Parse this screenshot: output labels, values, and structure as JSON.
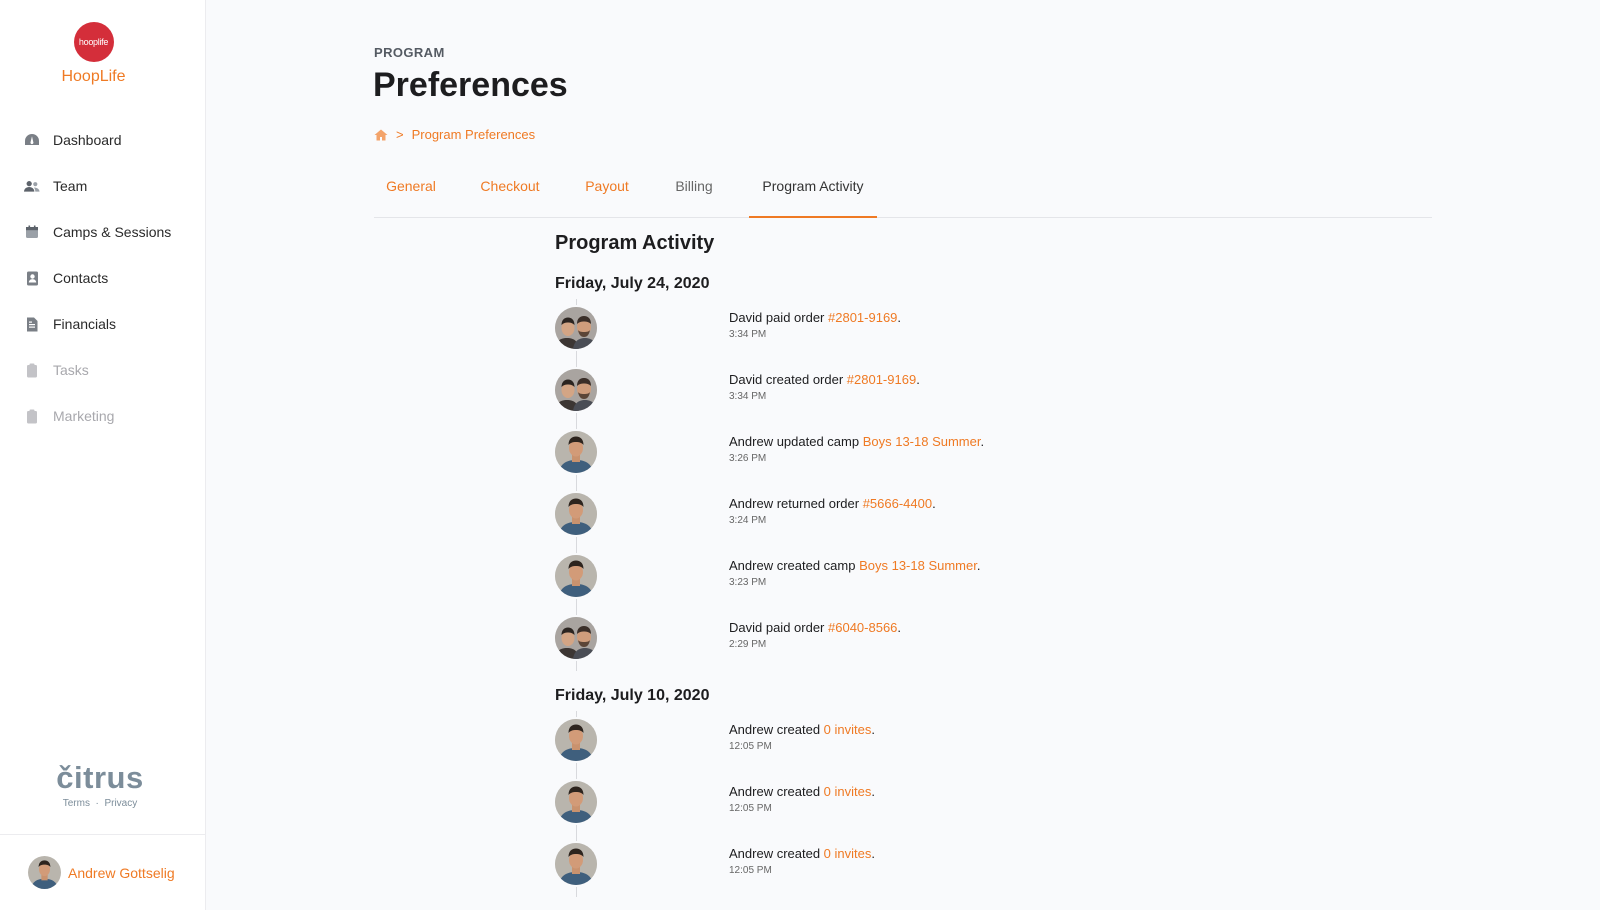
{
  "brand": {
    "logo_text": "hooplife",
    "name": "HoopLife"
  },
  "sidebar": {
    "items": [
      {
        "label": "Dashboard",
        "icon": "dashboard-icon",
        "enabled": true
      },
      {
        "label": "Team",
        "icon": "team-icon",
        "enabled": true
      },
      {
        "label": "Camps & Sessions",
        "icon": "calendar-icon",
        "enabled": true
      },
      {
        "label": "Contacts",
        "icon": "contacts-icon",
        "enabled": true
      },
      {
        "label": "Financials",
        "icon": "financials-icon",
        "enabled": true
      },
      {
        "label": "Tasks",
        "icon": "tasks-icon",
        "enabled": false
      },
      {
        "label": "Marketing",
        "icon": "marketing-icon",
        "enabled": false
      }
    ],
    "footer_brand": "čitrus",
    "terms": "Terms",
    "separator": "·",
    "privacy": "Privacy",
    "user": {
      "name": "Andrew Gottselig"
    }
  },
  "header": {
    "eyebrow": "PROGRAM",
    "title": "Preferences",
    "breadcrumb": {
      "separator": ">",
      "current": "Program Preferences"
    }
  },
  "tabs": [
    {
      "label": "General",
      "state": "link"
    },
    {
      "label": "Checkout",
      "state": "link"
    },
    {
      "label": "Payout",
      "state": "link"
    },
    {
      "label": "Billing",
      "state": "muted"
    },
    {
      "label": "Program Activity",
      "state": "active"
    }
  ],
  "activity": {
    "title": "Program Activity",
    "days": [
      {
        "date": "Friday, July 24, 2020",
        "items": [
          {
            "who": "david",
            "prefix": "David paid order ",
            "link": "#2801-9169",
            "suffix": ".",
            "time": "3:34 PM"
          },
          {
            "who": "david",
            "prefix": "David created order ",
            "link": "#2801-9169",
            "suffix": ".",
            "time": "3:34 PM"
          },
          {
            "who": "andrew",
            "prefix": "Andrew updated camp ",
            "link": "Boys 13-18 Summer",
            "suffix": ".",
            "time": "3:26 PM"
          },
          {
            "who": "andrew",
            "prefix": "Andrew returned order ",
            "link": "#5666-4400",
            "suffix": ".",
            "time": "3:24 PM"
          },
          {
            "who": "andrew",
            "prefix": "Andrew created camp ",
            "link": "Boys 13-18 Summer",
            "suffix": ".",
            "time": "3:23 PM"
          },
          {
            "who": "david",
            "prefix": "David paid order ",
            "link": "#6040-8566",
            "suffix": ".",
            "time": "2:29 PM"
          }
        ]
      },
      {
        "date": "Friday, July 10, 2020",
        "items": [
          {
            "who": "andrew",
            "prefix": "Andrew created ",
            "link": "0 invites",
            "suffix": ".",
            "time": "12:05 PM"
          },
          {
            "who": "andrew",
            "prefix": "Andrew created ",
            "link": "0 invites",
            "suffix": ".",
            "time": "12:05 PM"
          },
          {
            "who": "andrew",
            "prefix": "Andrew created ",
            "link": "0 invites",
            "suffix": ".",
            "time": "12:05 PM"
          }
        ]
      }
    ]
  },
  "colors": {
    "accent": "#ef7a24",
    "logo_red": "#d42e3a",
    "citrus_gray": "#7c8d9a",
    "background": "#f9fafc"
  }
}
